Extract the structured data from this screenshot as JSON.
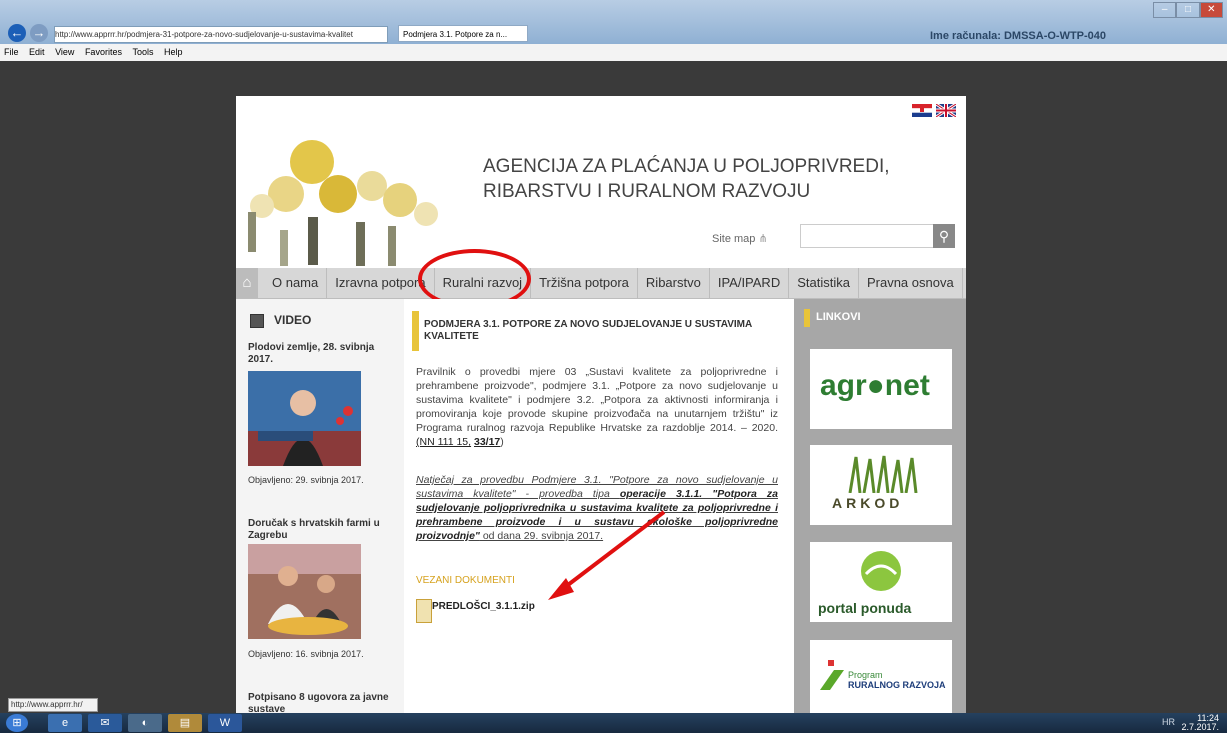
{
  "browser": {
    "url": "http://www.apprrr.hr/podmjera-31-potpore-za-novo-sudjelovanje-u-sustavima-kvalitet",
    "tab_title": "Podmjera 3.1. Potpore za n...",
    "computer_name": "Ime računala:   DMSSA-O-WTP-040",
    "menu": [
      "File",
      "Edit",
      "View",
      "Favorites",
      "Tools",
      "Help"
    ],
    "status_url": "http://www.apprrr.hr/"
  },
  "site": {
    "agency_title_line1": "AGENCIJA ZA PLAĆANJA U POLJOPRIVREDI,",
    "agency_title_line2": "RIBARSTVU I RURALNOM RAZVOJU",
    "sitemap_label": "Site map",
    "nav": [
      "O nama",
      "Izravna potpora",
      "Ruralni razvoj",
      "Tržišna potpora",
      "Ribarstvo",
      "IPA/IPARD",
      "Statistika",
      "Pravna osnova"
    ]
  },
  "left": {
    "video_heading": "VIDEO",
    "items": [
      {
        "title": "Plodovi zemlje, 28. svibnja 2017.",
        "date": "Objavljeno: 29. svibnja 2017."
      },
      {
        "title": "Doručak s hrvatskih farmi u Zagrebu",
        "date": "Objavljeno: 16. svibnja 2017."
      },
      {
        "title": "Potpisano 8 ugovora za javne sustave",
        "date": ""
      }
    ]
  },
  "main": {
    "heading": "PODMJERA 3.1. POTPORE ZA NOVO SUDJELOVANJE U SUSTAVIMA KVALITETE",
    "para1": "Pravilnik o provedbi mjere 03 „Sustavi kvalitete za poljoprivredne i prehrambene proizvode\", podmjere 3.1. „Potpore za novo sudjelovanje u sustavima kvalitete\" i podmjere 3.2. „Potpora za aktivnosti informiranja i promoviranja koje provode skupine proizvođača na unutarnjem tržištu\" iz Programa ruralnog razvoja Republike Hrvatske za razdoblje 2014. – 2020.",
    "para1_link1": "(NN 111 15,",
    "para1_link2": "33/17",
    "para1_end": ")",
    "para2_a": "Natječaj za provedbu Podmjere 3.1. \"Potpore za novo sudjelovanje u sustavima kvalitete\" - provedba tipa ",
    "para2_b": "operacije 3.1.1. \"Potpora za sudjelovanje poljoprivrednika u sustavima kvalitete za poljoprivredne i prehrambene proizvode i u sustavu ekološke poljoprivredne proizvodnje\"",
    "para2_c": " od dana 29. svibnja 2017.",
    "related_heading": "VEZANI DOKUMENTI",
    "doc_name": "PREDLOŠCI_3.1.1.zip"
  },
  "right": {
    "heading": "LINKOVI",
    "cards": [
      {
        "name": "agronet",
        "text": "agr●net"
      },
      {
        "name": "arkod",
        "text": "ARKOD"
      },
      {
        "name": "portal-ponuda",
        "text": "portal ponuda"
      },
      {
        "name": "program-ruralnog-razvoja",
        "text1": "Program",
        "text2": "RURALNOG RAZVOJA"
      }
    ]
  },
  "taskbar": {
    "lang": "HR",
    "time": "11:24",
    "date": "2.7.2017."
  },
  "colors": {
    "accent_yellow": "#e8c43a",
    "annotation_red": "#e01010",
    "nav_bg": "#d7d7d7"
  }
}
